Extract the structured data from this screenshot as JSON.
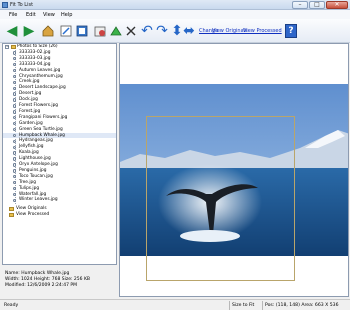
{
  "window": {
    "title": "Fit To List"
  },
  "menu": [
    "File",
    "Edit",
    "View",
    "Help"
  ],
  "toolbar": {
    "icons": [
      "back-arrow-icon",
      "forward-arrow-icon",
      "home-icon",
      "edit-icon",
      "settings-icon",
      "rotate-left-icon",
      "rotate-right-icon",
      "undo-icon",
      "redo-icon",
      "flip-icon",
      "tools-icon",
      "swap-icon"
    ],
    "links": [
      "Change",
      "View Originals",
      "View Processed"
    ],
    "help_label": "?"
  },
  "tree": {
    "root_label": "Photos to Size (26)",
    "items": [
      "333333-02.jpg",
      "333333-03.jpg",
      "333333-04.jpg",
      "Autumn Leaves.jpg",
      "Chrysanthemum.jpg",
      "Creek.jpg",
      "Desert Landscape.jpg",
      "Desert.jpg",
      "Dock.jpg",
      "Forest Flowers.jpg",
      "Forest.jpg",
      "Frangipani Flowers.jpg",
      "Garden.jpg",
      "Green Sea Turtle.jpg",
      "Humpback Whale.jpg",
      "Hydrangeas.jpg",
      "Jellyfish.jpg",
      "Koala.jpg",
      "Lighthouse.jpg",
      "Oryx Antelope.jpg",
      "Penguins.jpg",
      "Toco Toucan.jpg",
      "Tree.jpg",
      "Tulips.jpg",
      "Waterfall.jpg",
      "Winter Leaves.jpg"
    ],
    "selected_index": 14,
    "folders": [
      "View Originals",
      "View Processed"
    ]
  },
  "info": {
    "name": "Name: Humpback Whale.jpg",
    "dims": "Width: 1024   Height: 768   Size: 256 KB",
    "modified": "Modified: 12/6/2009 2:24:47 PM"
  },
  "status": {
    "ready": "Ready",
    "mode": "Size to Fit",
    "pos": "Pos: (118, 148) Area: 663 X 536"
  },
  "colors": {
    "sky": "#8fb3de",
    "sea": "#1d5d9b",
    "link": "#1030c0"
  }
}
